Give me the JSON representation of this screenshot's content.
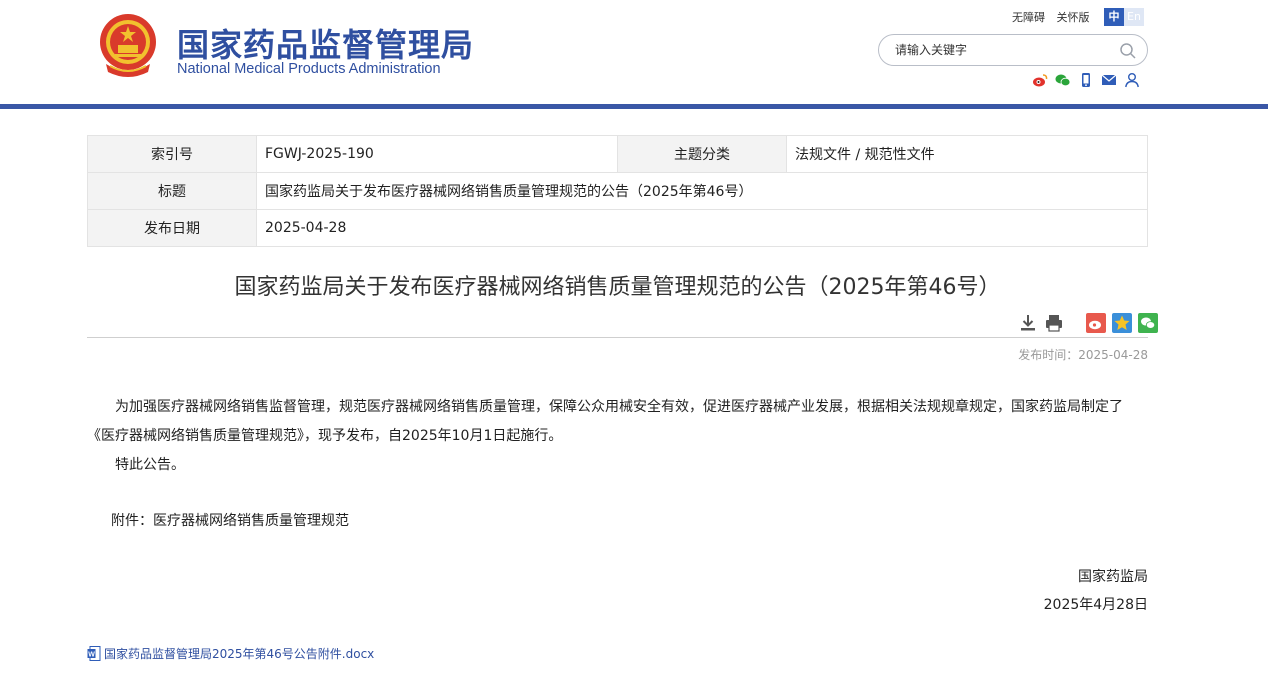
{
  "header": {
    "logo_cn": "国家药品监督管理局",
    "logo_en": "National Medical Products Administration",
    "accessibility": "无障碍",
    "care_mode": "关怀版",
    "lang_zh": "中",
    "lang_en": "En",
    "search_placeholder": "请输入关键字",
    "brand_color": "#2f4fa0",
    "social_icons": [
      "weibo-icon",
      "wechat-icon",
      "mobile-icon",
      "mail-icon",
      "user-icon"
    ]
  },
  "info": {
    "index_label": "索引号",
    "index_value": "FGWJ-2025-190",
    "category_label": "主题分类",
    "category_value": "法规文件 / 规范性文件",
    "title_label": "标题",
    "title_value": "国家药监局关于发布医疗器械网络销售质量管理规范的公告（2025年第46号）",
    "date_label": "发布日期",
    "date_value": "2025-04-28"
  },
  "article": {
    "title": "国家药监局关于发布医疗器械网络销售质量管理规范的公告（2025年第46号）",
    "publish_time": "发布时间：2025-04-28",
    "paragraph1": "为加强医疗器械网络销售监督管理，规范医疗器械网络销售质量管理，保障公众用械安全有效，促进医疗器械产业发展，根据相关法规规章规定，国家药监局制定了《医疗器械网络销售质量管理规范》，现予发布，自2025年10月1日起施行。",
    "paragraph2": "特此公告。",
    "attachment": "附件：医疗器械网络销售质量管理规范",
    "signature_org": "国家药监局",
    "signature_date": "2025年4月28日",
    "file_link": "国家药品监督管理局2025年第46号公告附件.docx"
  }
}
